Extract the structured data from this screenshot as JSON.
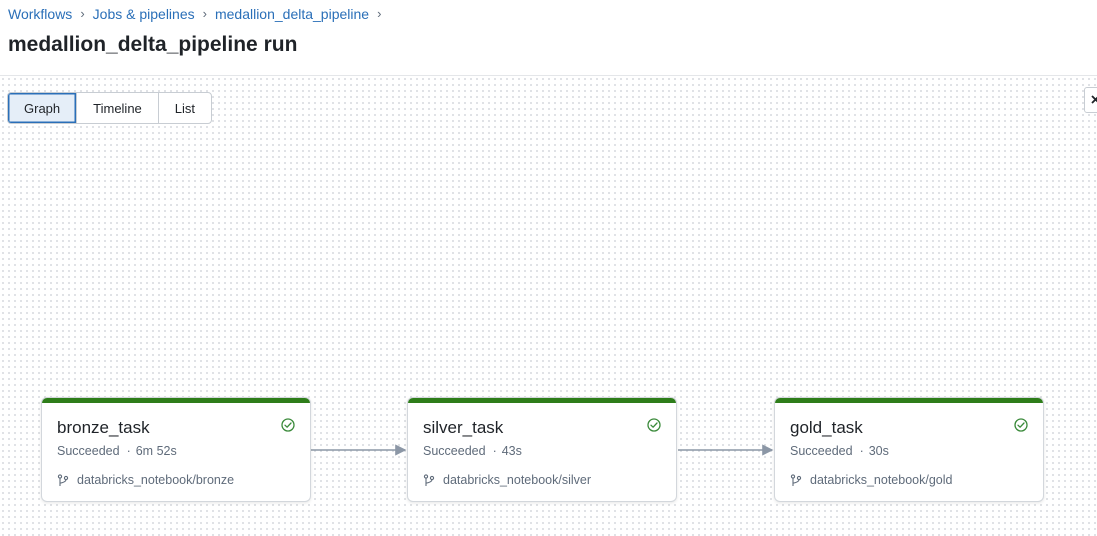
{
  "breadcrumb": [
    {
      "label": "Workflows"
    },
    {
      "label": "Jobs & pipelines"
    },
    {
      "label": "medallion_delta_pipeline"
    }
  ],
  "breadcrumb_separator": "›",
  "page_title": "medallion_delta_pipeline run",
  "views": [
    {
      "label": "Graph",
      "active": true
    },
    {
      "label": "Timeline",
      "active": false
    },
    {
      "label": "List",
      "active": false
    }
  ],
  "tasks": [
    {
      "name": "bronze_task",
      "status": "Succeeded",
      "duration": "6m 52s",
      "path": "databricks_notebook/bronze",
      "status_icon": "check-circle-icon"
    },
    {
      "name": "silver_task",
      "status": "Succeeded",
      "duration": "43s",
      "path": "databricks_notebook/silver",
      "status_icon": "check-circle-icon"
    },
    {
      "name": "gold_task",
      "status": "Succeeded",
      "duration": "30s",
      "path": "databricks_notebook/gold",
      "status_icon": "check-circle-icon"
    }
  ],
  "dependencies": [
    {
      "from": "bronze_task",
      "to": "silver_task"
    },
    {
      "from": "silver_task",
      "to": "gold_task"
    }
  ],
  "colors": {
    "success_bar": "#2e7d1a",
    "success_icon": "#3a8a3a",
    "link": "#2a6fb8",
    "edge": "#8c97a6"
  }
}
